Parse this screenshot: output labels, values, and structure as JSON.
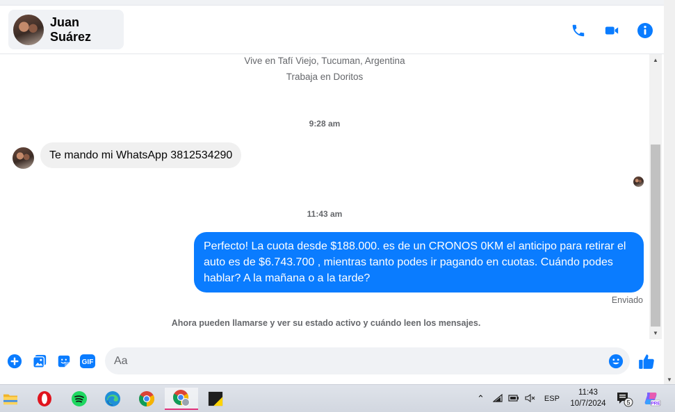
{
  "header": {
    "contact_name": "Juan Suárez",
    "actions": [
      "phone-icon",
      "video-icon",
      "info-icon"
    ],
    "accent": "#0a7cff"
  },
  "profile": {
    "location": "Vive en Tafí Viejo, Tucuman, Argentina",
    "work": "Trabaja en Doritos"
  },
  "messages": {
    "time_1": "9:28 am",
    "incoming_text": "Te mando mi WhatsApp 3812534290",
    "time_2": "11:43 am",
    "outgoing_text": "Perfecto! La cuota desde $188.000. es de un CRONOS 0KM el anticipo para retirar el auto es de $6.743.700 , mientras tanto podes ir pagando en cuotas. Cuándo podes hablar? A la mañana o a la tarde?",
    "status": "Enviado",
    "notice": "Ahora pueden llamarse y ver su estado activo y cuándo leen los mensajes."
  },
  "composer": {
    "placeholder": "Aa",
    "tools": [
      "plus-icon",
      "photo-icon",
      "sticker-icon",
      "gif-icon"
    ],
    "gif_label": "GIF"
  },
  "taskbar": {
    "apps": [
      "file-explorer-icon",
      "opera-icon",
      "spotify-icon",
      "edge-icon",
      "chrome-icon",
      "chrome-profile-icon",
      "sticky-notes-icon"
    ],
    "language": "ESP",
    "time": "11:43",
    "date": "10/7/2024",
    "notifications": "5",
    "pre_badge": "PRE"
  }
}
